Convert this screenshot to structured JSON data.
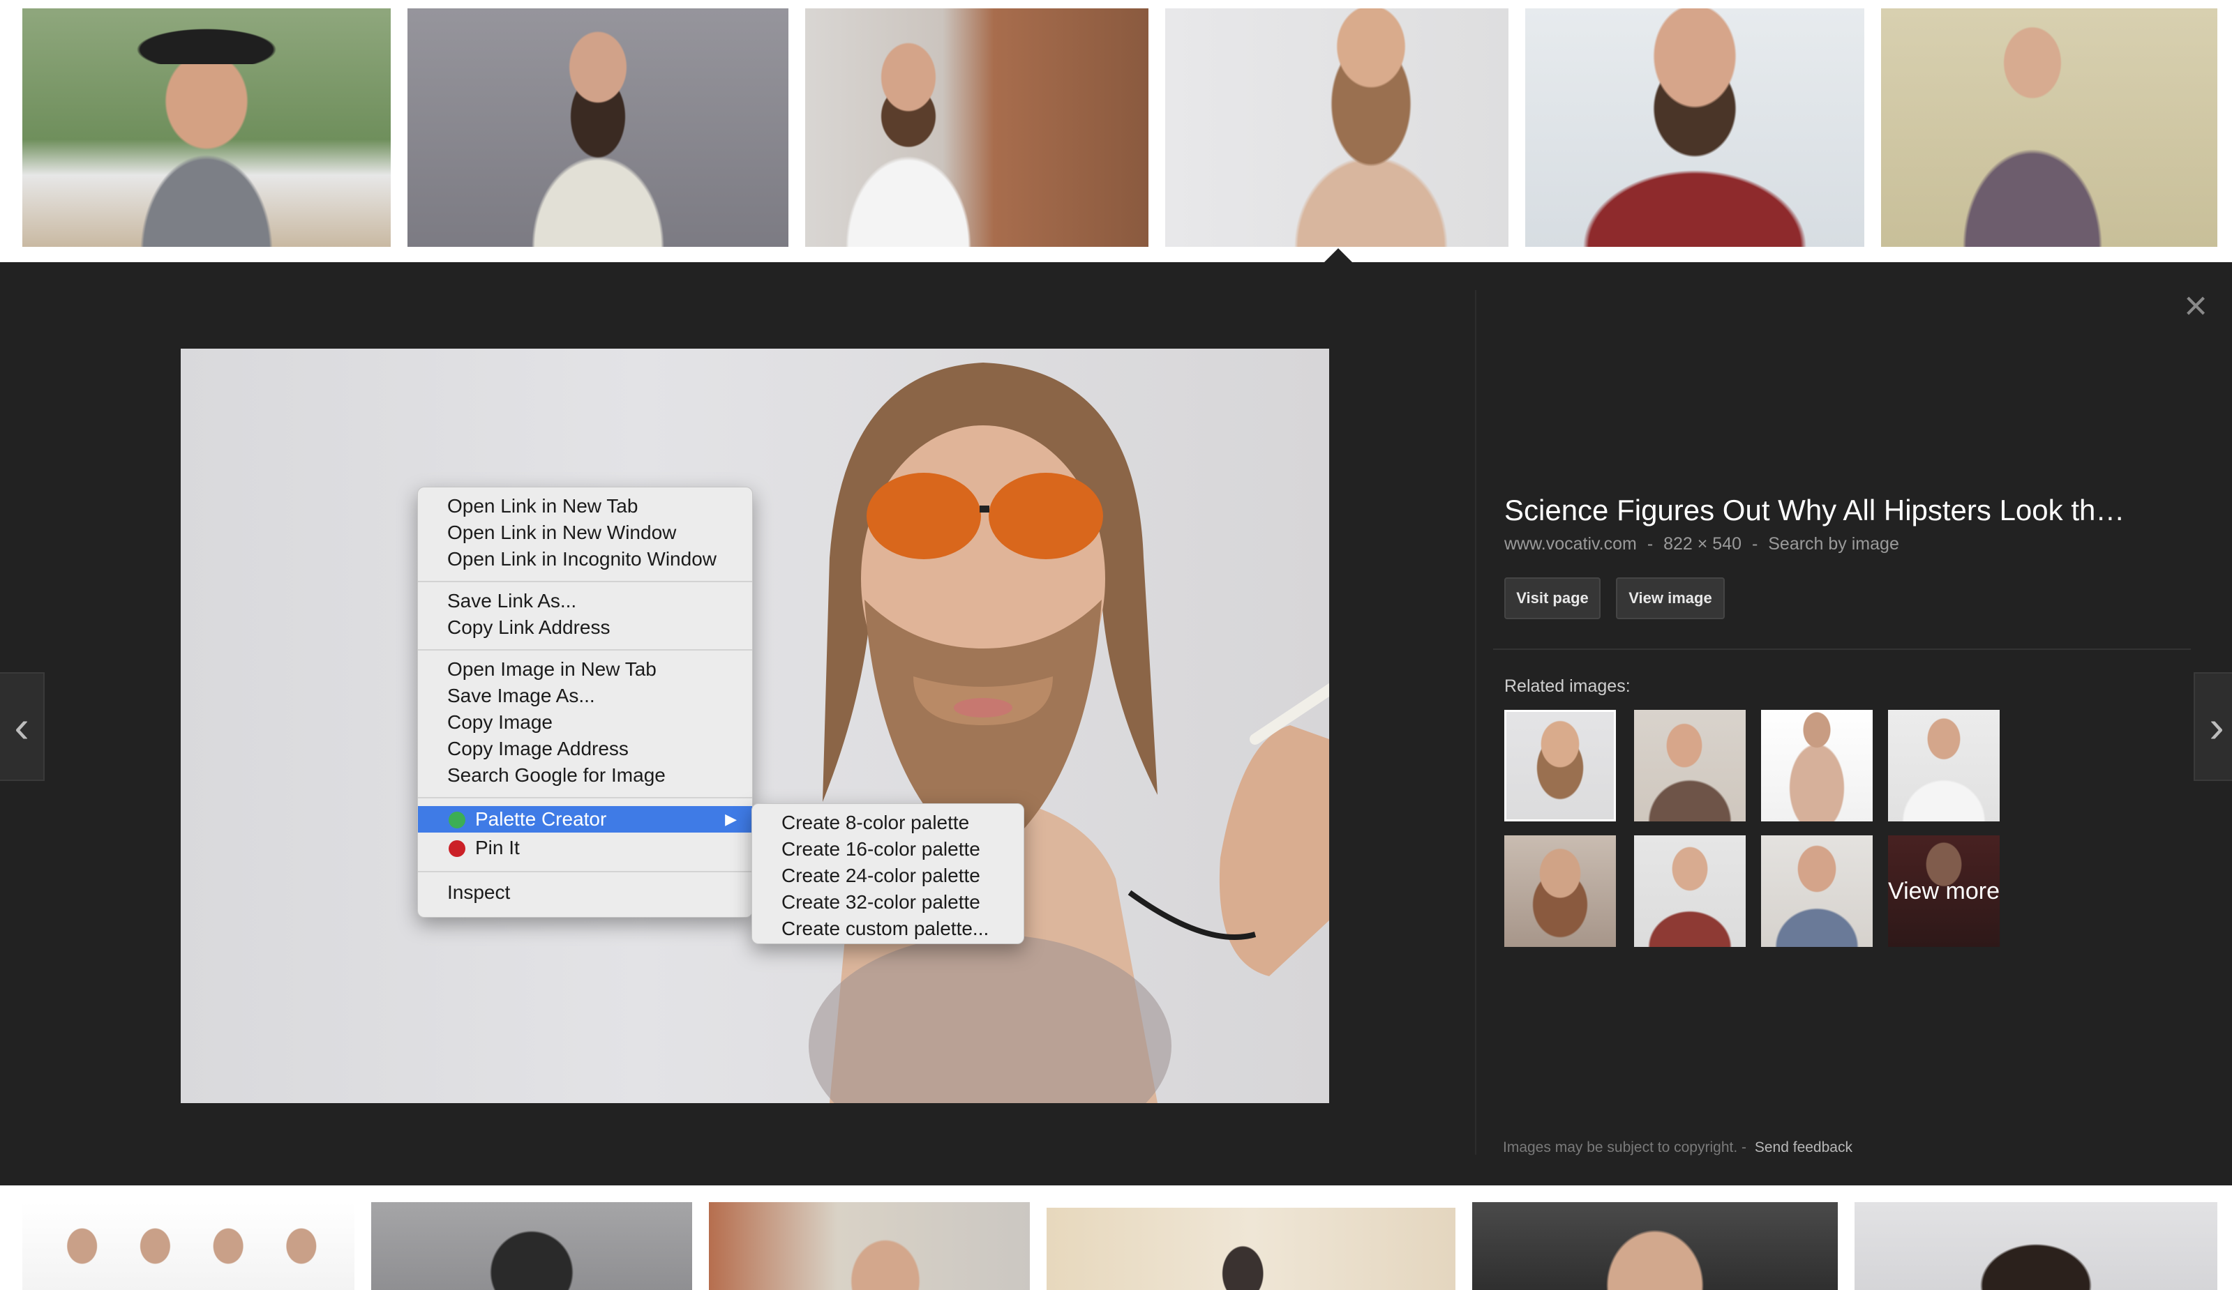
{
  "detail": {
    "title": "Science Figures Out Why All Hipsters Look th…",
    "domain": "www.vocativ.com",
    "separator": "-",
    "dimensions": "822 × 540",
    "search_by_image": "Search by image",
    "visit_page_label": "Visit page",
    "view_image_label": "View image",
    "related_label": "Related images:",
    "view_more_label": "View more",
    "copyright_note": "Images may be subject to copyright.",
    "send_feedback": "Send feedback",
    "close_glyph": "×",
    "prev_glyph": "‹",
    "next_glyph": "›"
  },
  "context_menu": {
    "items": [
      "Open Link in New Tab",
      "Open Link in New Window",
      "Open Link in Incognito Window",
      "Save Link As...",
      "Copy Link Address",
      "Open Image in New Tab",
      "Save Image As...",
      "Copy Image",
      "Copy Image Address",
      "Search Google for Image",
      "Palette Creator",
      "Pin It",
      "Inspect"
    ],
    "submenu_arrow": "▶",
    "submenu": [
      "Create 8-color palette",
      "Create 16-color palette",
      "Create 24-color palette",
      "Create 32-color palette",
      "Create custom palette..."
    ]
  },
  "colors": {
    "panel_bg": "#222222",
    "menu_highlight": "#3f7be6",
    "palette_icon": "#3cae55",
    "pin_icon": "#cb2027"
  },
  "icons": {
    "prev": "chevron-left-icon",
    "next": "chevron-right-icon",
    "close": "close-icon",
    "palette": "palette-creator-icon",
    "pin": "pinterest-icon"
  }
}
